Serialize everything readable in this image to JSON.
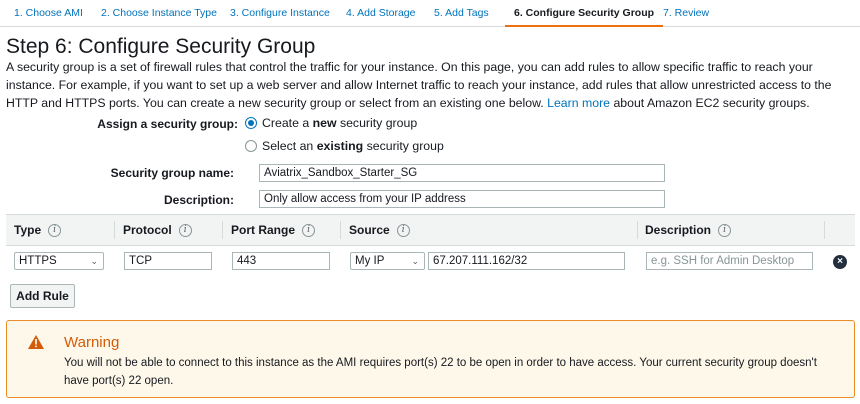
{
  "wizard": {
    "steps": [
      {
        "label": "1. Choose AMI",
        "active": false
      },
      {
        "label": "2. Choose Instance Type",
        "active": false
      },
      {
        "label": "3. Configure Instance",
        "active": false
      },
      {
        "label": "4. Add Storage",
        "active": false
      },
      {
        "label": "5. Add Tags",
        "active": false
      },
      {
        "label": "6. Configure Security Group",
        "active": true
      },
      {
        "label": "7. Review",
        "active": false
      }
    ]
  },
  "page": {
    "title": "Step 6: Configure Security Group",
    "intro": "A security group is a set of firewall rules that control the traffic for your instance. On this page, you can add rules to allow specific traffic to reach your instance. For example, if you want to set up a web server and allow Internet traffic to reach your instance, add rules that allow unrestricted access to the HTTP and HTTPS ports. You can create a new security group or select from an existing one below.",
    "learn_more": "Learn more",
    "intro_tail": "about Amazon EC2 security groups."
  },
  "form": {
    "assign_label": "Assign a security group:",
    "option_create": {
      "pre": "Create a ",
      "bold": "new",
      "post": " security group",
      "selected": true
    },
    "option_select": {
      "pre": "Select an ",
      "bold": "existing",
      "post": " security group",
      "selected": false
    },
    "name_label": "Security group name:",
    "name_value": "Aviatrix_Sandbox_Starter_SG",
    "desc_label": "Description:",
    "desc_value": "Only allow access from your IP address"
  },
  "rules_table": {
    "columns": [
      "Type",
      "Protocol",
      "Port Range",
      "Source",
      "Description"
    ],
    "info_glyph": "i",
    "rows": [
      {
        "type": "HTTPS",
        "protocol": "TCP",
        "port_range": "443",
        "source_type": "My IP",
        "source_cidr": "67.207.111.162/32",
        "description_value": "",
        "description_placeholder": "e.g. SSH for Admin Desktop"
      }
    ],
    "remove_glyph": "×",
    "add_rule_label": "Add Rule"
  },
  "warning": {
    "icon": "warning-triangle-icon",
    "title": "Warning",
    "message": "You will not be able to connect to this instance as the AMI requires port(s) 22 to be open in order to have access. Your current security group doesn't have port(s) 22 open."
  },
  "colors": {
    "link": "#0073bb",
    "active_tab_underline": "#ec7211",
    "warning_border": "#eb8c29",
    "warning_background": "#fef8ea",
    "warning_title": "#d45b07"
  }
}
